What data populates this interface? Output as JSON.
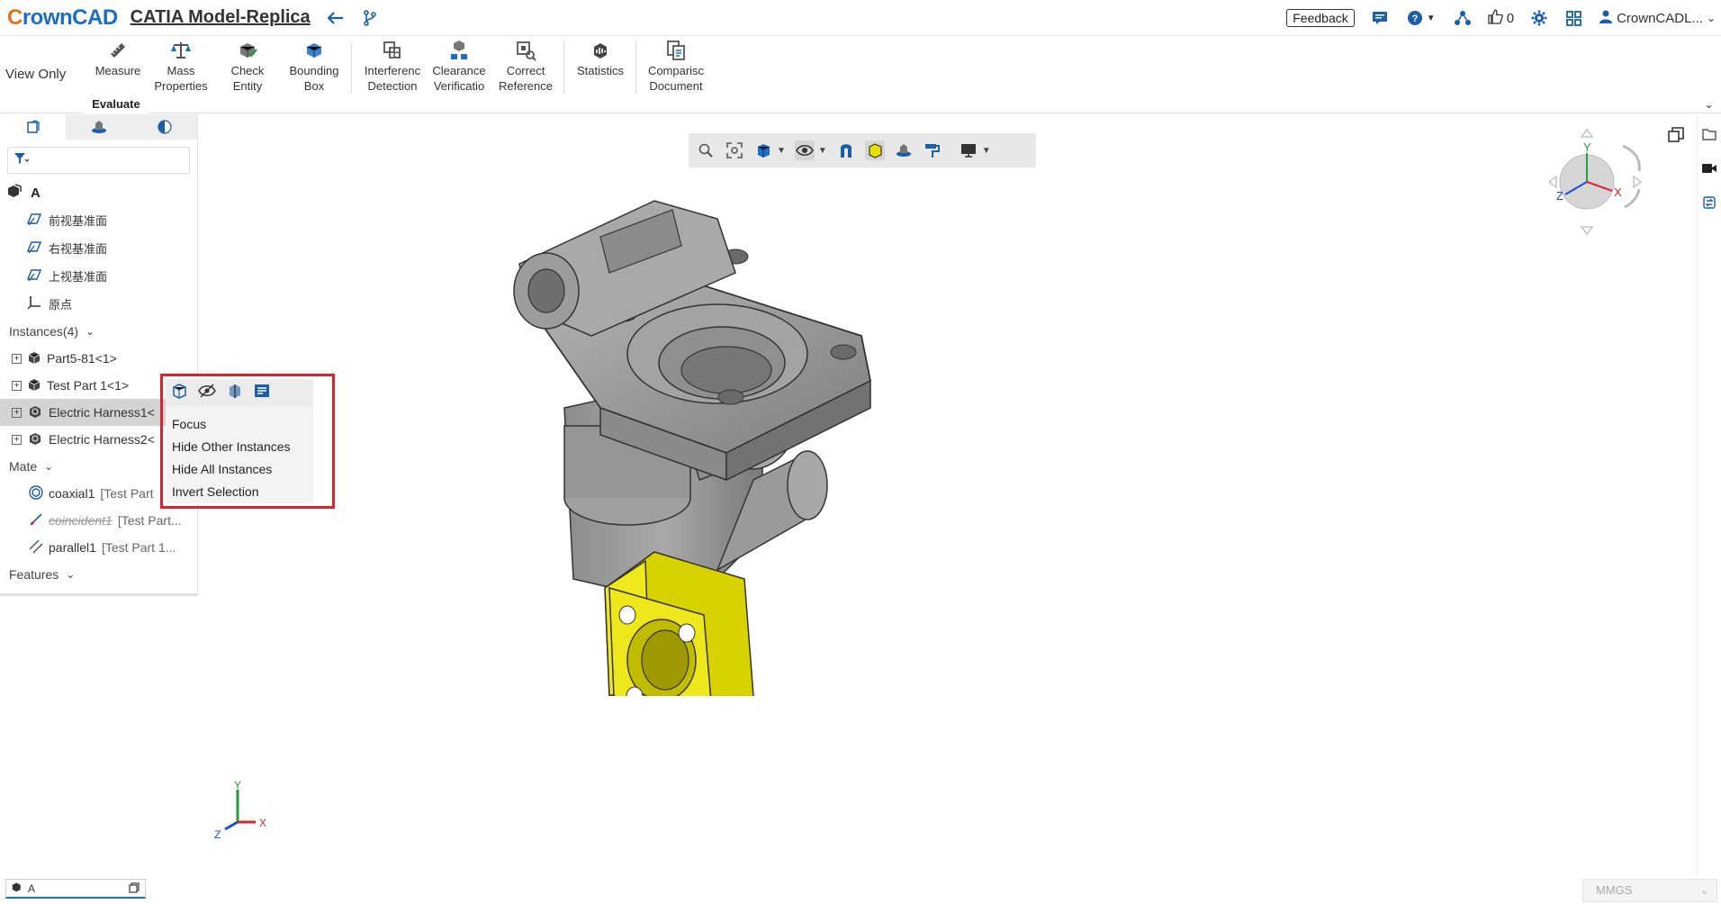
{
  "app": {
    "logo": "CrownCAD",
    "document_title": "CATIA Model-Replica"
  },
  "header_right": {
    "feedback": "Feedback",
    "likes": "0",
    "user": "CrownCADL..."
  },
  "ribbon": {
    "mode": "View Only",
    "active_tab": "Evaluate",
    "buttons": [
      {
        "label": "Measure"
      },
      {
        "label": "Mass\nProperties"
      },
      {
        "label": "Check\nEntity"
      },
      {
        "label": "Bounding\nBox"
      },
      {
        "label": "Interferenc\nDetection"
      },
      {
        "label": "Clearance\nVerificatio"
      },
      {
        "label": "Correct\nReference"
      },
      {
        "label": "Statistics"
      },
      {
        "label": "Comparisc\nDocument"
      }
    ]
  },
  "tree": {
    "root": "A",
    "planes": [
      "前视基准面",
      "右视基准面",
      "上视基准面"
    ],
    "origin": "原点",
    "instances_header": "Instances(4)",
    "instances": [
      {
        "label": "Part5-81<1>"
      },
      {
        "label": "Test Part 1<1>"
      },
      {
        "label": "Electric Harness1<"
      },
      {
        "label": "Electric Harness2<"
      }
    ],
    "mate_header": "Mate",
    "mates": [
      {
        "name": "coaxial1",
        "sub": "[Test Part"
      },
      {
        "name": "coincident1",
        "sub": "[Test Part..."
      },
      {
        "name": "parallel1",
        "sub": "[Test Part 1..."
      }
    ],
    "features_header": "Features"
  },
  "context_menu": {
    "items": [
      "Focus",
      "Hide Other Instances",
      "Hide All Instances",
      "Invert Selection"
    ]
  },
  "triad": {
    "x": "X",
    "y": "Y",
    "z": "Z"
  },
  "bottom": {
    "doc_tab": "A",
    "units": "MMGS"
  },
  "colors": {
    "accent": "#1a6fc2",
    "highlight_part": "#e6e000",
    "model_gray": "#9a9a9a",
    "context_border": "#e0202a"
  }
}
